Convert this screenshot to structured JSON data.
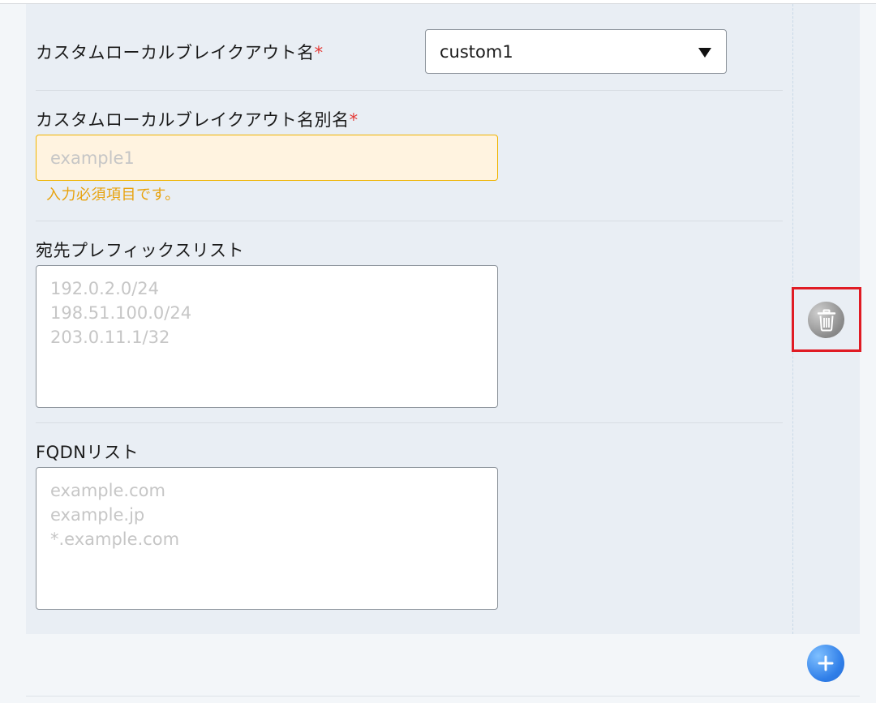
{
  "form": {
    "custom_name_label": "カスタムローカルブレイクアウト名",
    "required_mark": "*",
    "custom_name_value": "custom1",
    "alias_label": "カスタムローカルブレイクアウト名別名",
    "alias_placeholder": "example1",
    "alias_error": "入力必須項目です。",
    "prefix_label": "宛先プレフィックスリスト",
    "prefix_placeholder": "192.0.2.0/24\n198.51.100.0/24\n203.0.11.1/32",
    "fqdn_label": "FQDNリスト",
    "fqdn_placeholder": "example.com\nexample.jp\n*.example.com"
  },
  "icons": {
    "delete": "trash-icon",
    "add": "plus-icon"
  },
  "colors": {
    "required": "#e53935",
    "warning_border": "#f0b400",
    "warning_bg": "#fff3e0",
    "warning_text": "#e8a20c",
    "highlight": "#e01b24",
    "add_button": "#2f7ee8"
  }
}
